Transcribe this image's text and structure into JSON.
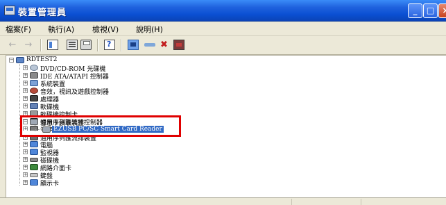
{
  "window": {
    "title": "裝置管理員",
    "icon": "device-manager-icon"
  },
  "title_buttons": [
    "minimize-icon",
    "maximize-icon",
    "close-icon"
  ],
  "menu": [
    {
      "label": "檔案(F)"
    },
    {
      "label": "執行(A)"
    },
    {
      "label": "檢視(V)"
    },
    {
      "label": "說明(H)"
    }
  ],
  "toolbar": {
    "back": "←",
    "forward": "→"
  },
  "tree": {
    "root": "RDTEST2",
    "items": [
      {
        "label": "DVD/CD-ROM 光碟機",
        "icon": "cdrom-icon"
      },
      {
        "label": "IDE ATA/ATAPI 控制器",
        "icon": "ide-controller-icon"
      },
      {
        "label": "系統裝置",
        "icon": "system-devices-icon"
      },
      {
        "label": "音效，視訊及遊戲控制器",
        "icon": "sound-icon"
      },
      {
        "label": "處理器",
        "icon": "processor-icon"
      },
      {
        "label": "軟碟機",
        "icon": "floppy-icon"
      },
      {
        "label": "軟碟機控制卡",
        "icon": "floppy-controller-icon"
      },
      {
        "label": "通用序列匯流排控制器",
        "icon": "usb-controller-icon"
      },
      {
        "label": "連接埠 (COM 和 LPT)",
        "icon": "port-icon"
      },
      {
        "label": "智慧卡讀取裝置",
        "icon": "smart-card-reader-icon"
      },
      {
        "label": "EZUSB PC/SC Smart Card Reader",
        "icon": "smart-card-device-icon"
      },
      {
        "label": "通用序列匯流排裝置",
        "icon": "usb-device-icon"
      },
      {
        "label": "電腦",
        "icon": "computer-icon"
      },
      {
        "label": "監視器",
        "icon": "monitor-icon"
      },
      {
        "label": "磁碟機",
        "icon": "disk-drive-icon"
      },
      {
        "label": "網路介面卡",
        "icon": "network-adapter-icon"
      },
      {
        "label": "鍵盤",
        "icon": "keyboard-icon"
      },
      {
        "label": "顯示卡",
        "icon": "display-adapter-icon"
      }
    ]
  },
  "colors": {
    "titlebar": "#0a4fd2",
    "selection": "#316ac5",
    "highlight_box": "#e00000"
  }
}
